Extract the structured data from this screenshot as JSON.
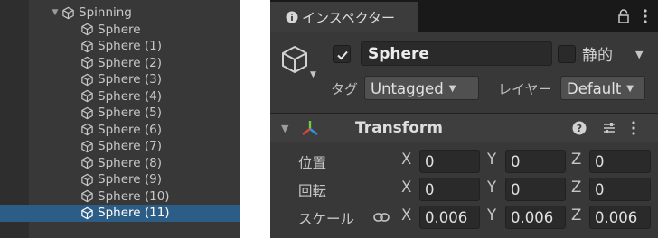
{
  "hierarchy": {
    "parent": {
      "label": "Spinning",
      "expanded": true
    },
    "children": [
      {
        "label": "Sphere",
        "selected": false
      },
      {
        "label": "Sphere (1)",
        "selected": false
      },
      {
        "label": "Sphere (2)",
        "selected": false
      },
      {
        "label": "Sphere (3)",
        "selected": false
      },
      {
        "label": "Sphere (4)",
        "selected": false
      },
      {
        "label": "Sphere (5)",
        "selected": false
      },
      {
        "label": "Sphere (6)",
        "selected": false
      },
      {
        "label": "Sphere (7)",
        "selected": false
      },
      {
        "label": "Sphere (8)",
        "selected": false
      },
      {
        "label": "Sphere (9)",
        "selected": false
      },
      {
        "label": "Sphere (10)",
        "selected": false
      },
      {
        "label": "Sphere (11)",
        "selected": true
      }
    ]
  },
  "inspector": {
    "tab_label": "インスペクター",
    "object": {
      "active": true,
      "name": "Sphere",
      "static_label": "静的",
      "static": false,
      "tag_label": "タグ",
      "tag_value": "Untagged",
      "layer_label": "レイヤー",
      "layer_value": "Default"
    },
    "transform": {
      "title": "Transform",
      "position_label": "位置",
      "rotation_label": "回転",
      "scale_label": "スケール",
      "axes": {
        "x": "X",
        "y": "Y",
        "z": "Z"
      },
      "position": {
        "x": "0",
        "y": "0",
        "z": "0"
      },
      "rotation": {
        "x": "0",
        "y": "0",
        "z": "0"
      },
      "scale": {
        "x": "0.006",
        "y": "0.006",
        "z": "0.006"
      }
    }
  },
  "colors": {
    "panel_bg": "#383838",
    "selection": "#2c5d87",
    "field_bg": "#2a2a2a",
    "transform_x_axis": "#e0433a",
    "transform_y_axis": "#6fcf3a",
    "transform_z_axis": "#3a8fe0"
  },
  "icons": {
    "hierarchy_item": "gameobject-cube-icon",
    "tab": "info-icon",
    "lock": "lock-icon",
    "component": "transform-icon"
  }
}
